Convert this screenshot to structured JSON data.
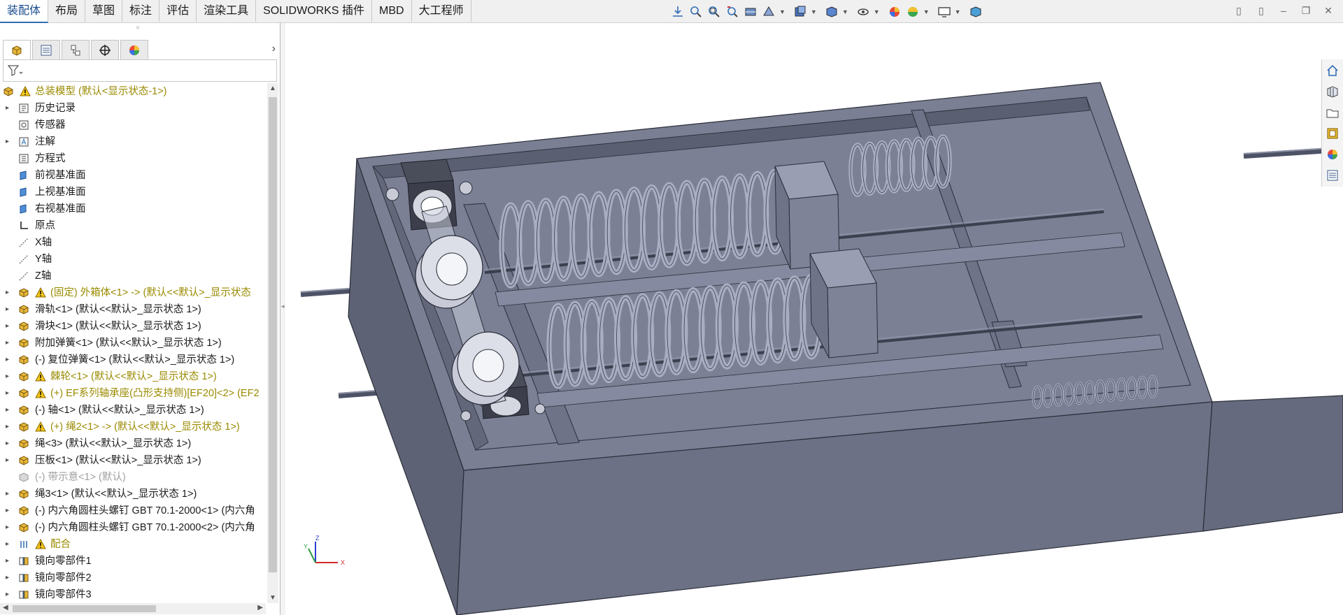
{
  "tabs": [
    {
      "label": "装配体",
      "active": true
    },
    {
      "label": "布局",
      "active": false
    },
    {
      "label": "草图",
      "active": false
    },
    {
      "label": "标注",
      "active": false
    },
    {
      "label": "评估",
      "active": false
    },
    {
      "label": "渲染工具",
      "active": false
    },
    {
      "label": "SOLIDWORKS 插件",
      "active": false
    },
    {
      "label": "MBD",
      "active": false
    },
    {
      "label": "大工程师",
      "active": false
    }
  ],
  "heads_up_toolbar": [
    "view-orientation-icon",
    "zoom-to-fit-icon",
    "zoom-to-area-icon",
    "previous-view-icon",
    "section-view-icon",
    "dynamic-annotation-icon",
    "view-orientation-dropdown-icon",
    "display-style-icon",
    "hide-show-icon",
    "edit-appearance-icon",
    "apply-scene-icon",
    "view-settings-icon",
    "display-pane-icon"
  ],
  "feature_tree": {
    "root": {
      "label": "总装模型  (默认<显示状态-1>)",
      "warning": true
    },
    "items": [
      {
        "label": "历史记录",
        "icon": "history-icon",
        "expandable": true,
        "color": "normal"
      },
      {
        "label": "传感器",
        "icon": "sensor-icon",
        "expandable": false,
        "color": "normal"
      },
      {
        "label": "注解",
        "icon": "annotation-icon",
        "expandable": true,
        "color": "normal"
      },
      {
        "label": "方程式",
        "icon": "equation-icon",
        "expandable": false,
        "color": "normal"
      },
      {
        "label": "前视基准面",
        "icon": "plane-icon",
        "expandable": false,
        "color": "normal"
      },
      {
        "label": "上视基准面",
        "icon": "plane-icon",
        "expandable": false,
        "color": "normal"
      },
      {
        "label": "右视基准面",
        "icon": "plane-icon",
        "expandable": false,
        "color": "normal"
      },
      {
        "label": "原点",
        "icon": "origin-icon",
        "expandable": false,
        "color": "normal"
      },
      {
        "label": "X轴",
        "icon": "axis-icon",
        "expandable": false,
        "color": "normal"
      },
      {
        "label": "Y轴",
        "icon": "axis-icon",
        "expandable": false,
        "color": "normal"
      },
      {
        "label": "Z轴",
        "icon": "axis-icon",
        "expandable": false,
        "color": "normal"
      },
      {
        "label": "(固定) 外箱体<1> -> (默认<<默认>_显示状态",
        "icon": "part-icon",
        "warning": true,
        "expandable": true,
        "color": "yellow"
      },
      {
        "label": "滑轨<1> (默认<<默认>_显示状态 1>)",
        "icon": "part-icon",
        "expandable": true,
        "color": "normal"
      },
      {
        "label": "滑块<1> (默认<<默认>_显示状态 1>)",
        "icon": "part-icon",
        "expandable": true,
        "color": "normal"
      },
      {
        "label": "附加弹簧<1> (默认<<默认>_显示状态 1>)",
        "icon": "part-icon",
        "expandable": true,
        "color": "normal"
      },
      {
        "label": "(-) 复位弹簧<1> (默认<<默认>_显示状态 1>)",
        "icon": "part-icon",
        "expandable": true,
        "color": "normal"
      },
      {
        "label": "棘轮<1> (默认<<默认>_显示状态 1>)",
        "icon": "part-icon",
        "warning": true,
        "expandable": true,
        "color": "yellow"
      },
      {
        "label": "(+) EF系列轴承座(凸形支持侧)[EF20]<2> (EF2",
        "icon": "part-icon",
        "warning": true,
        "expandable": true,
        "color": "yellow"
      },
      {
        "label": "(-) 轴<1> (默认<<默认>_显示状态 1>)",
        "icon": "part-icon",
        "expandable": true,
        "color": "normal"
      },
      {
        "label": "(+) 绳2<1> -> (默认<<默认>_显示状态 1>)",
        "icon": "part-icon",
        "warning": true,
        "expandable": true,
        "color": "yellow"
      },
      {
        "label": "绳<3> (默认<<默认>_显示状态 1>)",
        "icon": "part-icon",
        "expandable": true,
        "color": "normal"
      },
      {
        "label": "压板<1> (默认<<默认>_显示状态 1>)",
        "icon": "part-icon",
        "expandable": true,
        "color": "normal"
      },
      {
        "label": "(-) 带示意<1> (默认)",
        "icon": "part-grey-icon",
        "expandable": false,
        "color": "grey"
      },
      {
        "label": "绳3<1> (默认<<默认>_显示状态 1>)",
        "icon": "part-icon",
        "expandable": true,
        "color": "normal"
      },
      {
        "label": "(-) 内六角圆柱头螺钉 GBT 70.1-2000<1> (内六角",
        "icon": "part-icon",
        "expandable": true,
        "color": "normal"
      },
      {
        "label": "(-) 内六角圆柱头螺钉 GBT 70.1-2000<2> (内六角",
        "icon": "part-icon",
        "expandable": true,
        "color": "normal"
      },
      {
        "label": "配合",
        "icon": "mate-icon",
        "warning": true,
        "expandable": true,
        "color": "yellow"
      },
      {
        "label": "镜向零部件1",
        "icon": "mirror-icon",
        "expandable": true,
        "color": "normal"
      },
      {
        "label": "镜向零部件2",
        "icon": "mirror-icon",
        "expandable": true,
        "color": "normal"
      },
      {
        "label": "镜向零部件3",
        "icon": "mirror-icon",
        "expandable": true,
        "color": "normal"
      }
    ]
  },
  "right_taskpane": [
    "home-icon",
    "3d-library-icon",
    "file-explorer-icon",
    "view-palette-icon",
    "appearances-icon",
    "custom-properties-icon"
  ],
  "triad": {
    "x_label": "X",
    "y_label": "Y",
    "z_label": "Z"
  },
  "colors": {
    "model_face": "#6c7186",
    "model_top": "#5f6478",
    "model_side": "#7b8095",
    "spring": "#a9adc2",
    "accent_blue": "#2f6db5",
    "warning_yellow": "#f5c518"
  }
}
